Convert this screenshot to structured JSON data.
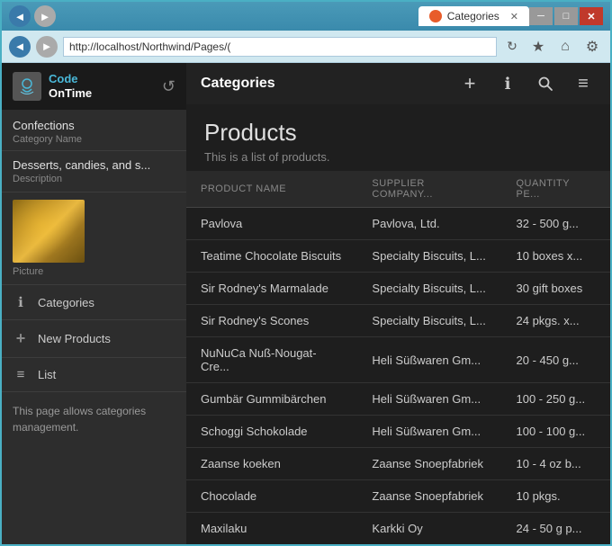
{
  "window": {
    "title": "Categories",
    "address": "http://localhost/Northwind/Pages/(",
    "tab_icon_color": "#e85c2a"
  },
  "titlebar": {
    "minimize_label": "─",
    "maximize_label": "□",
    "close_label": "✕"
  },
  "addressbar": {
    "back_icon": "◄",
    "forward_icon": "►",
    "refresh_icon": "↻",
    "star_icon": "★",
    "gear_icon": "⚙"
  },
  "sidebar": {
    "logo_line1": "Code",
    "logo_line2": "OnTime",
    "logo_refresh_icon": "↺",
    "category_name_label": "Category Name",
    "category_name_value": "Confections",
    "description_label": "Description",
    "description_value": "Desserts, candies, and s...",
    "picture_label": "Picture",
    "nav_items": [
      {
        "id": "categories",
        "icon": "ℹ",
        "label": "Categories"
      },
      {
        "id": "new-products",
        "icon": "+",
        "label": "New Products"
      },
      {
        "id": "list",
        "icon": "≡",
        "label": "List"
      }
    ],
    "info_text": "This page allows categories management."
  },
  "topbar": {
    "title": "Categories",
    "add_icon": "+",
    "info_icon": "ℹ",
    "search_icon": "🔍",
    "menu_icon": "≡"
  },
  "content": {
    "page_title": "Products",
    "subtitle": "This is a list of products.",
    "table": {
      "columns": [
        {
          "id": "product_name",
          "label": "PRODUCT NAME"
        },
        {
          "id": "supplier",
          "label": "SUPPLIER COMPANY..."
        },
        {
          "id": "quantity",
          "label": "QUANTITY PE..."
        }
      ],
      "rows": [
        {
          "product_name": "Pavlova",
          "supplier": "Pavlova, Ltd.",
          "quantity": "32 - 500 g..."
        },
        {
          "product_name": "Teatime Chocolate Biscuits",
          "supplier": "Specialty Biscuits, L...",
          "quantity": "10 boxes x..."
        },
        {
          "product_name": "Sir Rodney's Marmalade",
          "supplier": "Specialty Biscuits, L...",
          "quantity": "30 gift boxes"
        },
        {
          "product_name": "Sir Rodney's Scones",
          "supplier": "Specialty Biscuits, L...",
          "quantity": "24 pkgs. x..."
        },
        {
          "product_name": "NuNuCa Nuß-Nougat-Cre...",
          "supplier": "Heli Süßwaren Gm...",
          "quantity": "20 - 450 g..."
        },
        {
          "product_name": "Gumbär Gummibärchen",
          "supplier": "Heli Süßwaren Gm...",
          "quantity": "100 - 250 g..."
        },
        {
          "product_name": "Schoggi Schokolade",
          "supplier": "Heli Süßwaren Gm...",
          "quantity": "100 - 100 g..."
        },
        {
          "product_name": "Zaanse koeken",
          "supplier": "Zaanse Snoepfabriek",
          "quantity": "10 - 4 oz b..."
        },
        {
          "product_name": "Chocolade",
          "supplier": "Zaanse Snoepfabriek",
          "quantity": "10 pkgs."
        },
        {
          "product_name": "Maxilaku",
          "supplier": "Karkki Oy",
          "quantity": "24 - 50 g p..."
        }
      ]
    }
  }
}
